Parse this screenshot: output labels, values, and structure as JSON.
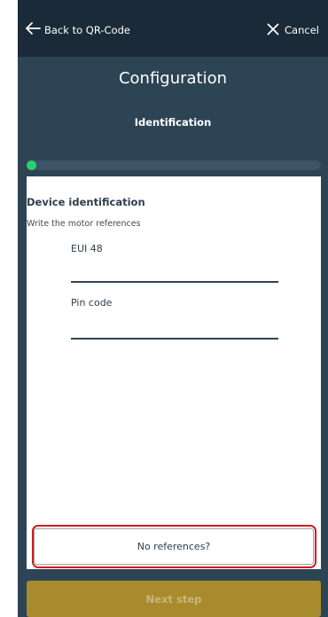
{
  "header": {
    "back_label": "Back to QR-Code",
    "cancel_label": "Cancel"
  },
  "page": {
    "title": "Configuration",
    "step": "Identification",
    "progress": 0.02
  },
  "card": {
    "title": "Device identification",
    "subtitle": "Write the motor references",
    "fields": [
      {
        "label": "EUI 48",
        "value": ""
      },
      {
        "label": "Pin code",
        "value": ""
      }
    ]
  },
  "actions": {
    "no_references_label": "No references?",
    "next_label": "Next step",
    "next_enabled": false
  },
  "colors": {
    "background": "#2d4455",
    "topbar": "#1a2a38",
    "progress": "#27d06e",
    "highlight": "#d3191f",
    "next_disabled": "#a88b2d"
  },
  "icons": {
    "back": "arrow-left-icon",
    "cancel": "close-icon"
  }
}
